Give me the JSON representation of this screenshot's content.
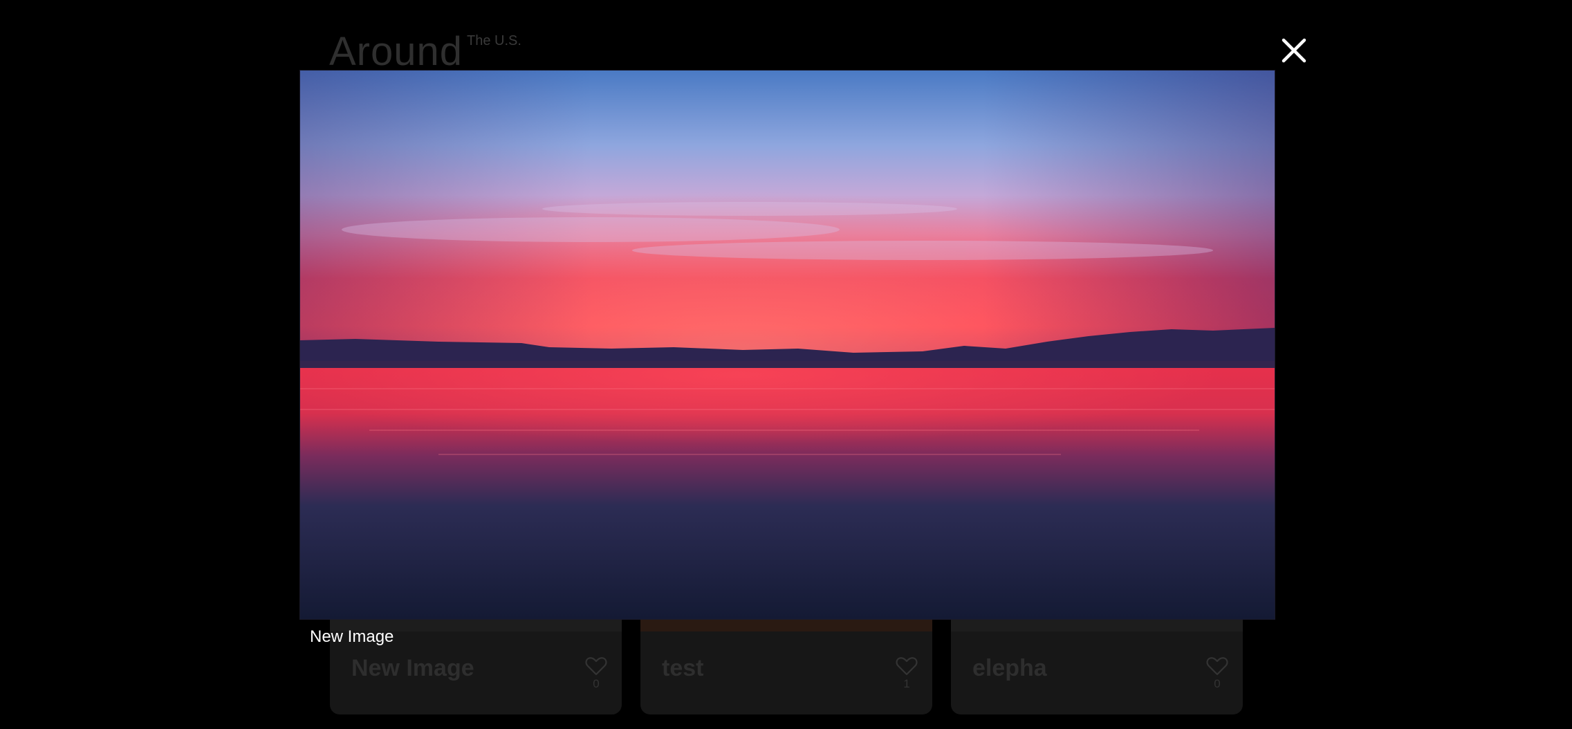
{
  "header": {
    "logo": "Around",
    "logo_sup": "The U.S."
  },
  "cards": [
    {
      "title": "New Image",
      "likes": "0"
    },
    {
      "title": "test",
      "likes": "1"
    },
    {
      "title": "elepha",
      "likes": "0"
    }
  ],
  "popup": {
    "caption": "New Image",
    "close_icon": "close-icon"
  },
  "colors": {
    "background": "#000000",
    "card": "#171717",
    "caption_text": "#ffffff"
  }
}
